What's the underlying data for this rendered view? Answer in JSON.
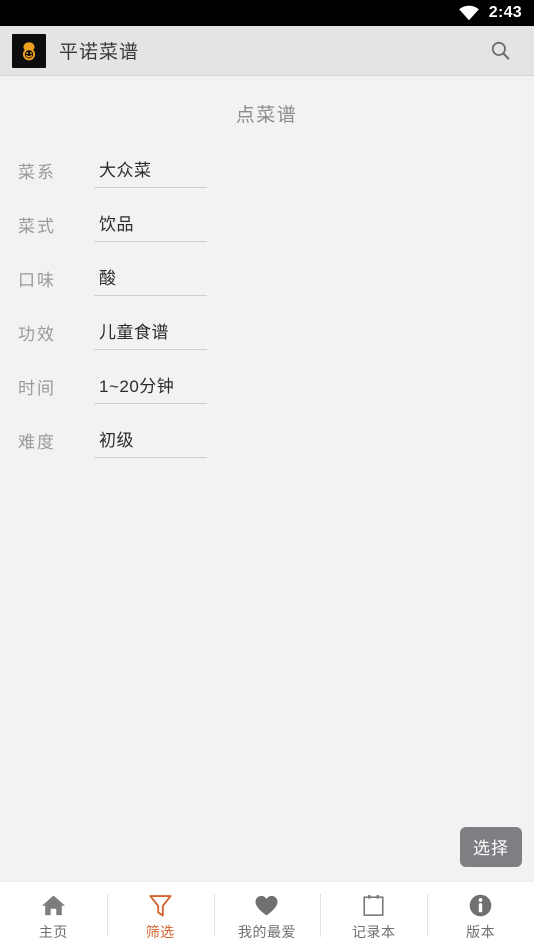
{
  "status_bar": {
    "wifi_icon": "wifi-icon",
    "time": "2:43"
  },
  "app_bar": {
    "logo_icon": "app-logo-chef-icon",
    "title": "平诺菜谱",
    "search_icon": "search-icon"
  },
  "main": {
    "heading": "点菜谱",
    "fields": [
      {
        "label": "菜系",
        "value": "大众菜"
      },
      {
        "label": "菜式",
        "value": "饮品"
      },
      {
        "label": "口味",
        "value": "酸"
      },
      {
        "label": "功效",
        "value": "儿童食谱"
      },
      {
        "label": "时间",
        "value": "1~20分钟"
      },
      {
        "label": "难度",
        "value": "初级"
      }
    ],
    "select_button": "选择"
  },
  "bottom_nav": {
    "items": [
      {
        "label": "主页",
        "icon": "home-icon",
        "active": false
      },
      {
        "label": "筛选",
        "icon": "filter-funnel-icon",
        "active": true
      },
      {
        "label": "我的最爱",
        "icon": "heart-icon",
        "active": false
      },
      {
        "label": "记录本",
        "icon": "clipboard-icon",
        "active": false
      },
      {
        "label": "版本",
        "icon": "info-circle-icon",
        "active": false
      }
    ]
  },
  "colors": {
    "accent": "#d2622f",
    "background": "#f2f2f2",
    "app_bar": "#e4e4e4",
    "status_bar": "#000000",
    "nav_bar": "#ffffff",
    "label_text": "#9a9a9a",
    "value_text": "#2c2c2c",
    "button_bg": "#7d7f83",
    "logo_orange": "#f0a020"
  }
}
